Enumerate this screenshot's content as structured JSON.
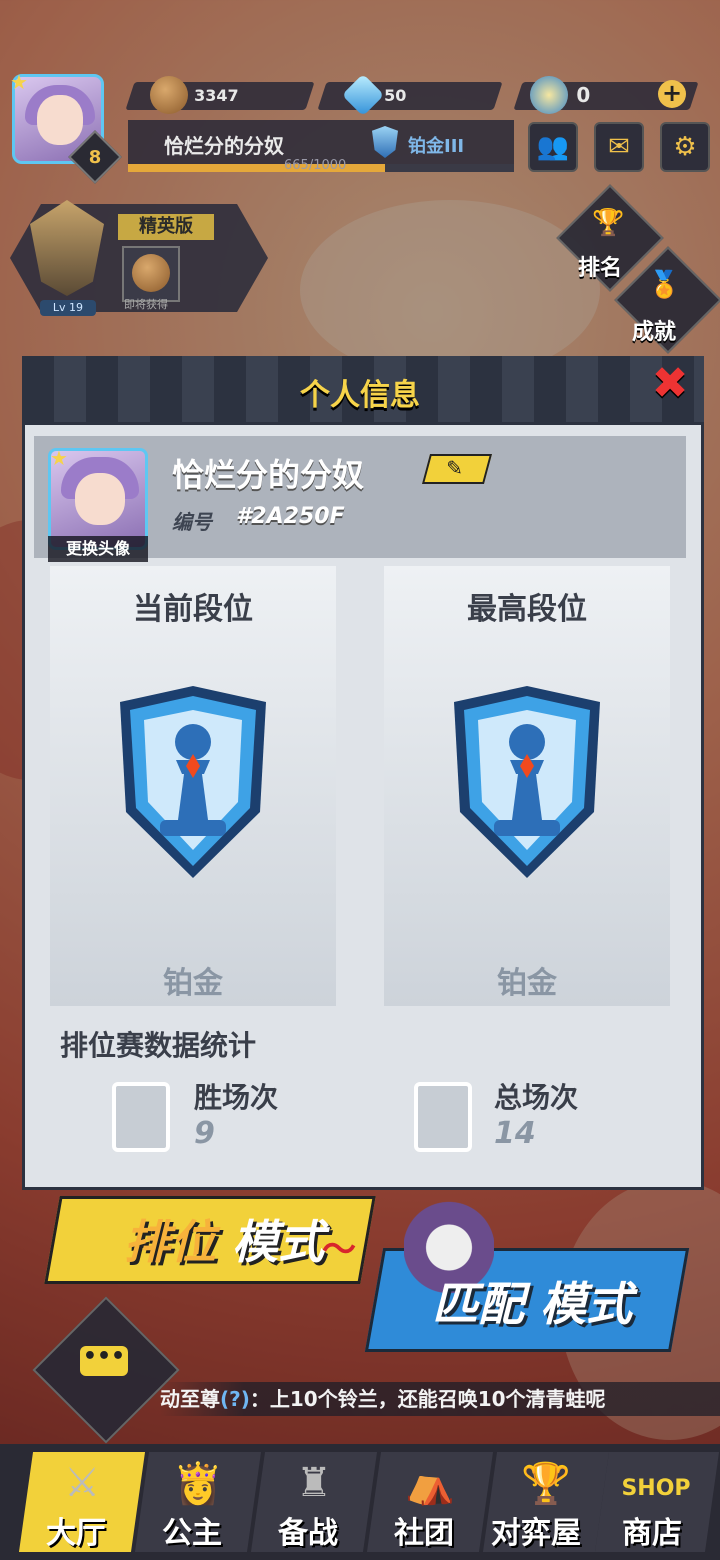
{
  "header": {
    "level": "8",
    "resources": [
      {
        "icon": "potato-icon",
        "value": "3347"
      },
      {
        "icon": "diamond-icon",
        "value": "50"
      },
      {
        "icon": "coin-icon",
        "value": "0"
      }
    ],
    "player_name": "恰烂分的分奴",
    "rank_label": "铂金III",
    "xp_text": "665/1000",
    "xp_fraction": 0.665
  },
  "elite": {
    "title": "精英版",
    "pending_label": "即将获得",
    "level": "Lv 19"
  },
  "side_buttons": {
    "ranking": "排名",
    "achievement": "成就"
  },
  "modal": {
    "title": "个人信息",
    "profile": {
      "name": "恰烂分的分奴",
      "change_avatar": "更换头像",
      "id_label": "编号",
      "id_value": "#2A250F"
    },
    "current_rank": {
      "title": "当前段位",
      "name": "铂金"
    },
    "highest_rank": {
      "title": "最高段位",
      "name": "铂金"
    },
    "stats": {
      "title": "排位赛数据统计",
      "wins_label": "胜场次",
      "wins_value": "9",
      "total_label": "总场次",
      "total_value": "14"
    }
  },
  "modes": {
    "rank_a": "排位",
    "rank_b": "模式",
    "match_a": "匹配",
    "match_b": "模式"
  },
  "ticker": {
    "prefix": "动至尊",
    "q": "(?)",
    "text": "：上10个铃兰，还能召唤10个清青蛙呢"
  },
  "nav": [
    {
      "label": "大厅",
      "icon": "swords-icon"
    },
    {
      "label": "公主",
      "icon": "princess-icon"
    },
    {
      "label": "备战",
      "icon": "chess-pieces-icon"
    },
    {
      "label": "社团",
      "icon": "club-icon"
    },
    {
      "label": "对弈屋",
      "icon": "trophy-icon"
    },
    {
      "label": "商店",
      "icon": "shop-icon",
      "badge": "SHOP"
    }
  ],
  "colors": {
    "accent_yellow": "#f2d13a",
    "rank_blue": "#2f8bd8",
    "close_red": "#e33333"
  }
}
